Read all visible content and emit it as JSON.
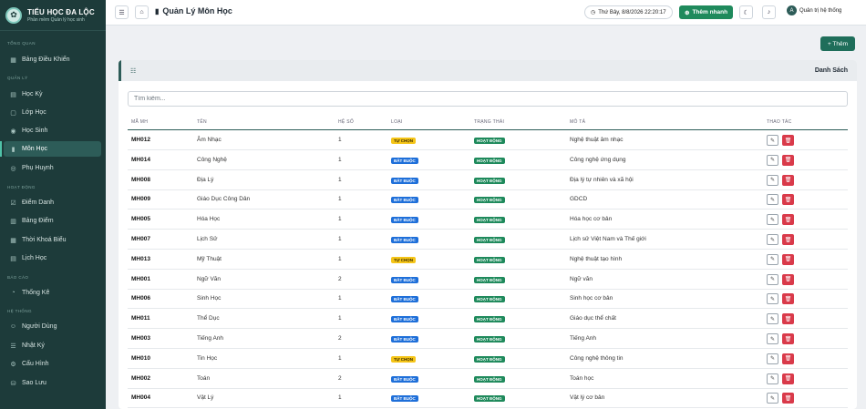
{
  "brand": {
    "title": "TIỂU HỌC ĐA LỘC",
    "subtitle": "Phần mềm Quản lý học sinh"
  },
  "sidebar": {
    "sections": [
      "TỔNG QUAN",
      "QUẢN LÝ",
      "HOẠT ĐỘNG",
      "BÁO CÁO",
      "HỆ THỐNG"
    ],
    "items": [
      {
        "label": "Bảng Điều Khiển",
        "icon": "dashboard-icon"
      },
      {
        "label": "Học Kỳ",
        "icon": "calendar-icon"
      },
      {
        "label": "Lớp Học",
        "icon": "class-icon"
      },
      {
        "label": "Học Sinh",
        "icon": "student-icon"
      },
      {
        "label": "Môn Học",
        "icon": "book-icon"
      },
      {
        "label": "Phụ Huynh",
        "icon": "parent-icon"
      },
      {
        "label": "Điểm Danh",
        "icon": "attendance-icon"
      },
      {
        "label": "Bảng Điểm",
        "icon": "chart-icon"
      },
      {
        "label": "Thời Khoá Biểu",
        "icon": "timetable-icon"
      },
      {
        "label": "Lịch Học",
        "icon": "schedule-icon"
      },
      {
        "label": "Thống Kê",
        "icon": "statistics-icon"
      },
      {
        "label": "Người Dùng",
        "icon": "users-icon"
      },
      {
        "label": "Nhật Ký",
        "icon": "log-icon"
      },
      {
        "label": "Cấu Hình",
        "icon": "gear-icon"
      },
      {
        "label": "Sao Lưu",
        "icon": "backup-icon"
      }
    ]
  },
  "topbar": {
    "title": "Quản Lý Môn Học",
    "datetime": "Thứ Bảy, 8/8/2026 22:20:17",
    "quick_add": "Thêm nhanh",
    "user": "Quản trị hệ thống",
    "avatar": "A"
  },
  "toolbar": {
    "add_label": "+ Thêm"
  },
  "card": {
    "title": "Danh Sách"
  },
  "search": {
    "placeholder": "Tìm kiếm..."
  },
  "table": {
    "headers": [
      "MÃ MH",
      "TÊN",
      "HỆ SỐ",
      "LOẠI",
      "TRẠNG THÁI",
      "MÔ TẢ",
      "THAO TÁC"
    ],
    "rows": [
      {
        "code": "MH012",
        "name": "Âm Nhạc",
        "coef": "1",
        "type": "TỰ CHỌN",
        "status": "HOẠT ĐỘNG",
        "desc": "Nghệ thuật âm nhạc"
      },
      {
        "code": "MH014",
        "name": "Công Nghệ",
        "coef": "1",
        "type": "BẮT BUỘC",
        "status": "HOẠT ĐỘNG",
        "desc": "Công nghệ ứng dụng"
      },
      {
        "code": "MH008",
        "name": "Địa Lý",
        "coef": "1",
        "type": "BẮT BUỘC",
        "status": "HOẠT ĐỘNG",
        "desc": "Địa lý tự nhiên và xã hội"
      },
      {
        "code": "MH009",
        "name": "Giáo Dục Công Dân",
        "coef": "1",
        "type": "BẮT BUỘC",
        "status": "HOẠT ĐỘNG",
        "desc": "GDCD"
      },
      {
        "code": "MH005",
        "name": "Hóa Học",
        "coef": "1",
        "type": "BẮT BUỘC",
        "status": "HOẠT ĐỘNG",
        "desc": "Hóa học cơ bản"
      },
      {
        "code": "MH007",
        "name": "Lịch Sử",
        "coef": "1",
        "type": "BẮT BUỘC",
        "status": "HOẠT ĐỘNG",
        "desc": "Lịch sử Việt Nam và Thế giới"
      },
      {
        "code": "MH013",
        "name": "Mỹ Thuật",
        "coef": "1",
        "type": "TỰ CHỌN",
        "status": "HOẠT ĐỘNG",
        "desc": "Nghệ thuật tạo hình"
      },
      {
        "code": "MH001",
        "name": "Ngữ Văn",
        "coef": "2",
        "type": "BẮT BUỘC",
        "status": "HOẠT ĐỘNG",
        "desc": "Ngữ văn"
      },
      {
        "code": "MH006",
        "name": "Sinh Học",
        "coef": "1",
        "type": "BẮT BUỘC",
        "status": "HOẠT ĐỘNG",
        "desc": "Sinh học cơ bản"
      },
      {
        "code": "MH011",
        "name": "Thể Dục",
        "coef": "1",
        "type": "BẮT BUỘC",
        "status": "HOẠT ĐỘNG",
        "desc": "Giáo dục thể chất"
      },
      {
        "code": "MH003",
        "name": "Tiếng Anh",
        "coef": "2",
        "type": "BẮT BUỘC",
        "status": "HOẠT ĐỘNG",
        "desc": "Tiếng Anh"
      },
      {
        "code": "MH010",
        "name": "Tin Học",
        "coef": "1",
        "type": "TỰ CHỌN",
        "status": "HOẠT ĐỘNG",
        "desc": "Công nghệ thông tin"
      },
      {
        "code": "MH002",
        "name": "Toán",
        "coef": "2",
        "type": "BẮT BUỘC",
        "status": "HOẠT ĐỘNG",
        "desc": "Toán học"
      },
      {
        "code": "MH004",
        "name": "Vật Lý",
        "coef": "1",
        "type": "BẮT BUỘC",
        "status": "HOẠT ĐỘNG",
        "desc": "Vật lý cơ bản"
      }
    ]
  },
  "colors": {
    "sidebar": "#1d3b3a",
    "accent": "#1f8a5c",
    "optional": "#f5c518",
    "required": "#1e6fd9",
    "danger": "#d93a4a"
  }
}
